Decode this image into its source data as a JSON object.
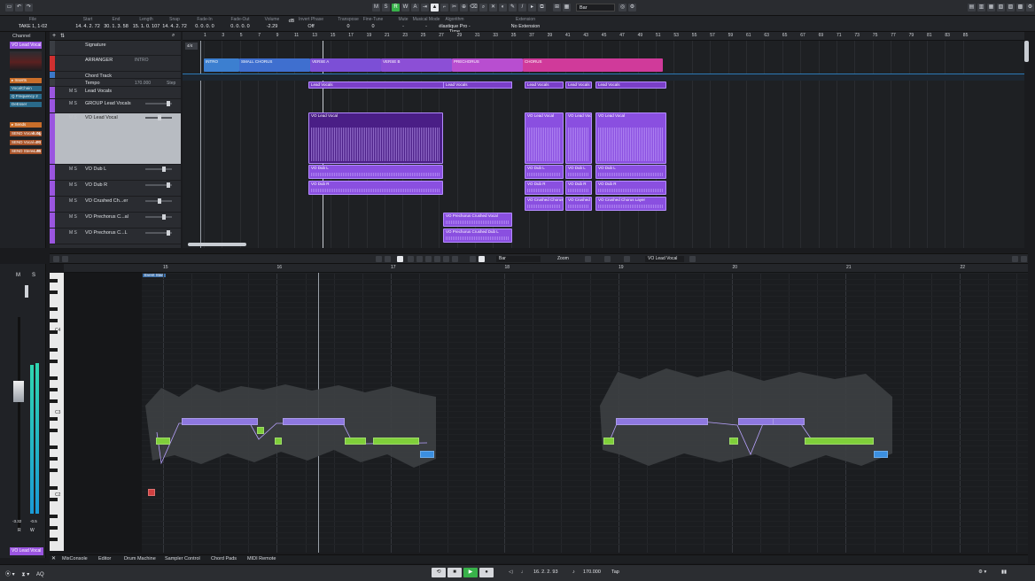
{
  "toolbar": {
    "buttons": [
      "M",
      "S",
      "R",
      "W",
      "A"
    ],
    "grid_type": "Bar"
  },
  "infoline": {
    "columns": [
      {
        "h": "File",
        "v": "TAKE 1, 1-02"
      },
      {
        "h": "Start",
        "v": "14. 4. 2. 72"
      },
      {
        "h": "End",
        "v": "30. 1. 3. 58"
      },
      {
        "h": "Length",
        "v": "15. 1. 0. 107"
      },
      {
        "h": "Snap",
        "v": "14. 4. 2. 72"
      },
      {
        "h": "Fade-In",
        "v": "0. 0. 0. 0"
      },
      {
        "h": "Fade-Out",
        "v": "0. 0. 0. 0"
      },
      {
        "h": "Volume",
        "v": "-2.29"
      },
      {
        "h": "",
        "v": "dB"
      },
      {
        "h": "Invert Phase",
        "v": "Off"
      },
      {
        "h": "Transpose",
        "v": "0"
      },
      {
        "h": "Fine-Tune",
        "v": "0"
      },
      {
        "h": "Mute",
        "v": "-"
      },
      {
        "h": "Musical Mode",
        "v": "-"
      },
      {
        "h": "Algorithm",
        "v": "élastique Pro - Time"
      },
      {
        "h": "Extension",
        "v": "No Extension"
      }
    ]
  },
  "inspector": {
    "title": "Channel",
    "track_name": "VO Lead Vocal",
    "inserts_title": "Inserts",
    "inserts": [
      "VocalChain",
      "Q Frequency 2",
      "DeEsser"
    ],
    "sends_title": "Sends",
    "sends": [
      {
        "name": "SEND Vocal...ng",
        "val": "-8.01"
      },
      {
        "name": "SEND Vocal...Rt",
        "val": "-4.4"
      },
      {
        "name": "SEND Stere...Rt",
        "val": "-4.45"
      }
    ]
  },
  "tracks": [
    {
      "name": "Signature",
      "color": "#3a3d43"
    },
    {
      "name": "ARRANGER",
      "sub": "INTRO",
      "color": "#d03030"
    },
    {
      "name": "Chord Track",
      "color": "#3c78c8"
    },
    {
      "name": "Tempo",
      "sub": "170.000",
      "extra": "Step",
      "color": "#3a3d43"
    },
    {
      "name": "Lead Vocals",
      "color": "#9a55e0"
    },
    {
      "name": "GROUP Lead Vocals",
      "color": "#9a55e0"
    },
    {
      "name": "VO Lead Vocal",
      "color": "#9a55e0"
    },
    {
      "name": "VO Dub L",
      "color": "#9a55e0"
    },
    {
      "name": "VO Dub R",
      "color": "#9a55e0"
    },
    {
      "name": "VO Crushed Ch...er",
      "color": "#9a55e0"
    },
    {
      "name": "VO Prechorus C...al",
      "color": "#9a55e0"
    },
    {
      "name": "VO Prechorus C...L",
      "color": "#9a55e0"
    }
  ],
  "ruler_marks": [
    "1",
    "3",
    "5",
    "7",
    "9",
    "11",
    "13",
    "15",
    "17",
    "19",
    "21",
    "23",
    "25",
    "27",
    "29",
    "31",
    "33",
    "35",
    "37",
    "39",
    "41",
    "43",
    "45",
    "47",
    "49",
    "51",
    "53",
    "55",
    "57",
    "59",
    "61",
    "63",
    "65",
    "67",
    "69",
    "71",
    "73",
    "75",
    "77",
    "79",
    "81",
    "83",
    "85"
  ],
  "arranger": [
    {
      "label": "INTRO"
    },
    {
      "label": "SMALL CHORUS"
    },
    {
      "label": "VERSE A"
    },
    {
      "label": "VERSE B"
    },
    {
      "label": "PRECHORUS"
    },
    {
      "label": "CHORUS"
    }
  ],
  "events": {
    "lead_vocals": "Lead Vocals",
    "vo_lead_vocal": "VO Lead Vocal",
    "vo_dub_l": "VO Dub L",
    "vo_dub_r": "VO Dub R",
    "vo_crushed": "VO Crushed Chorus",
    "vo_crushed_layer": "VO Crushed Chorus Layer",
    "vo_prechorus_vocal": "VO Prechorus Crushed Vocal",
    "vo_prechorus_dub": "VO Prechorus Crushed Dub L"
  },
  "editor": {
    "grid": "Bar",
    "zoom": "Zoom",
    "track": "VO Lead Vocal",
    "ruler": [
      "15",
      "16",
      "17",
      "18",
      "19",
      "20",
      "21",
      "22"
    ],
    "event_start": "Event Start",
    "keys": [
      "C4",
      "C3",
      "C2"
    ]
  },
  "leftstrip": {
    "m": "M",
    "s": "S",
    "r": "R",
    "w": "W",
    "db_left": "-3.32",
    "db_right": "-0.5",
    "track_name": "VO Lead Vocal"
  },
  "bottom_tabs": [
    "MixConsole",
    "Editor",
    "Drum Machine",
    "Sampler Control",
    "Chord Pads",
    "MIDI Remote"
  ],
  "transport": {
    "position": "16. 2. 2. 93",
    "tempo": "170.000",
    "tap": "Tap"
  }
}
